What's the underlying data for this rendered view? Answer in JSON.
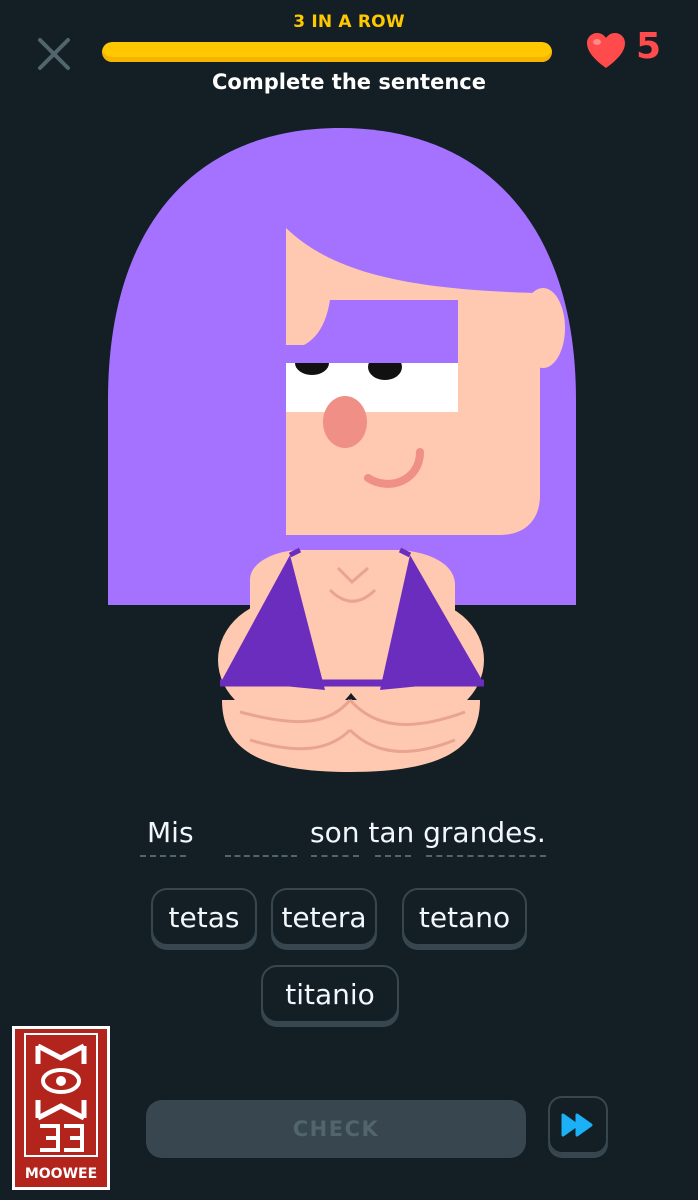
{
  "header": {
    "streak_label": "3 IN A ROW",
    "progress_percent": 100,
    "hearts": "5",
    "close_icon": "close-icon",
    "heart_icon": "heart-icon"
  },
  "instruction": "Complete the sentence",
  "sentence": {
    "before": "Mis",
    "after": "son tan grandes."
  },
  "word_bank": [
    "tetas",
    "tetera",
    "tetano",
    "titanio"
  ],
  "footer": {
    "check_label": "CHECK",
    "skip_icon": "fast-forward-icon"
  },
  "watermark": {
    "text": "MOOWEE"
  },
  "colors": {
    "background": "#131f24",
    "accent_yellow": "#ffc800",
    "heart_red": "#ff4b4b",
    "chip_border": "#37464f",
    "hair_purple": "#a571ff",
    "skin": "#ffc8b0",
    "bikini": "#6a2dbd",
    "skip_blue": "#1cb0f6"
  }
}
